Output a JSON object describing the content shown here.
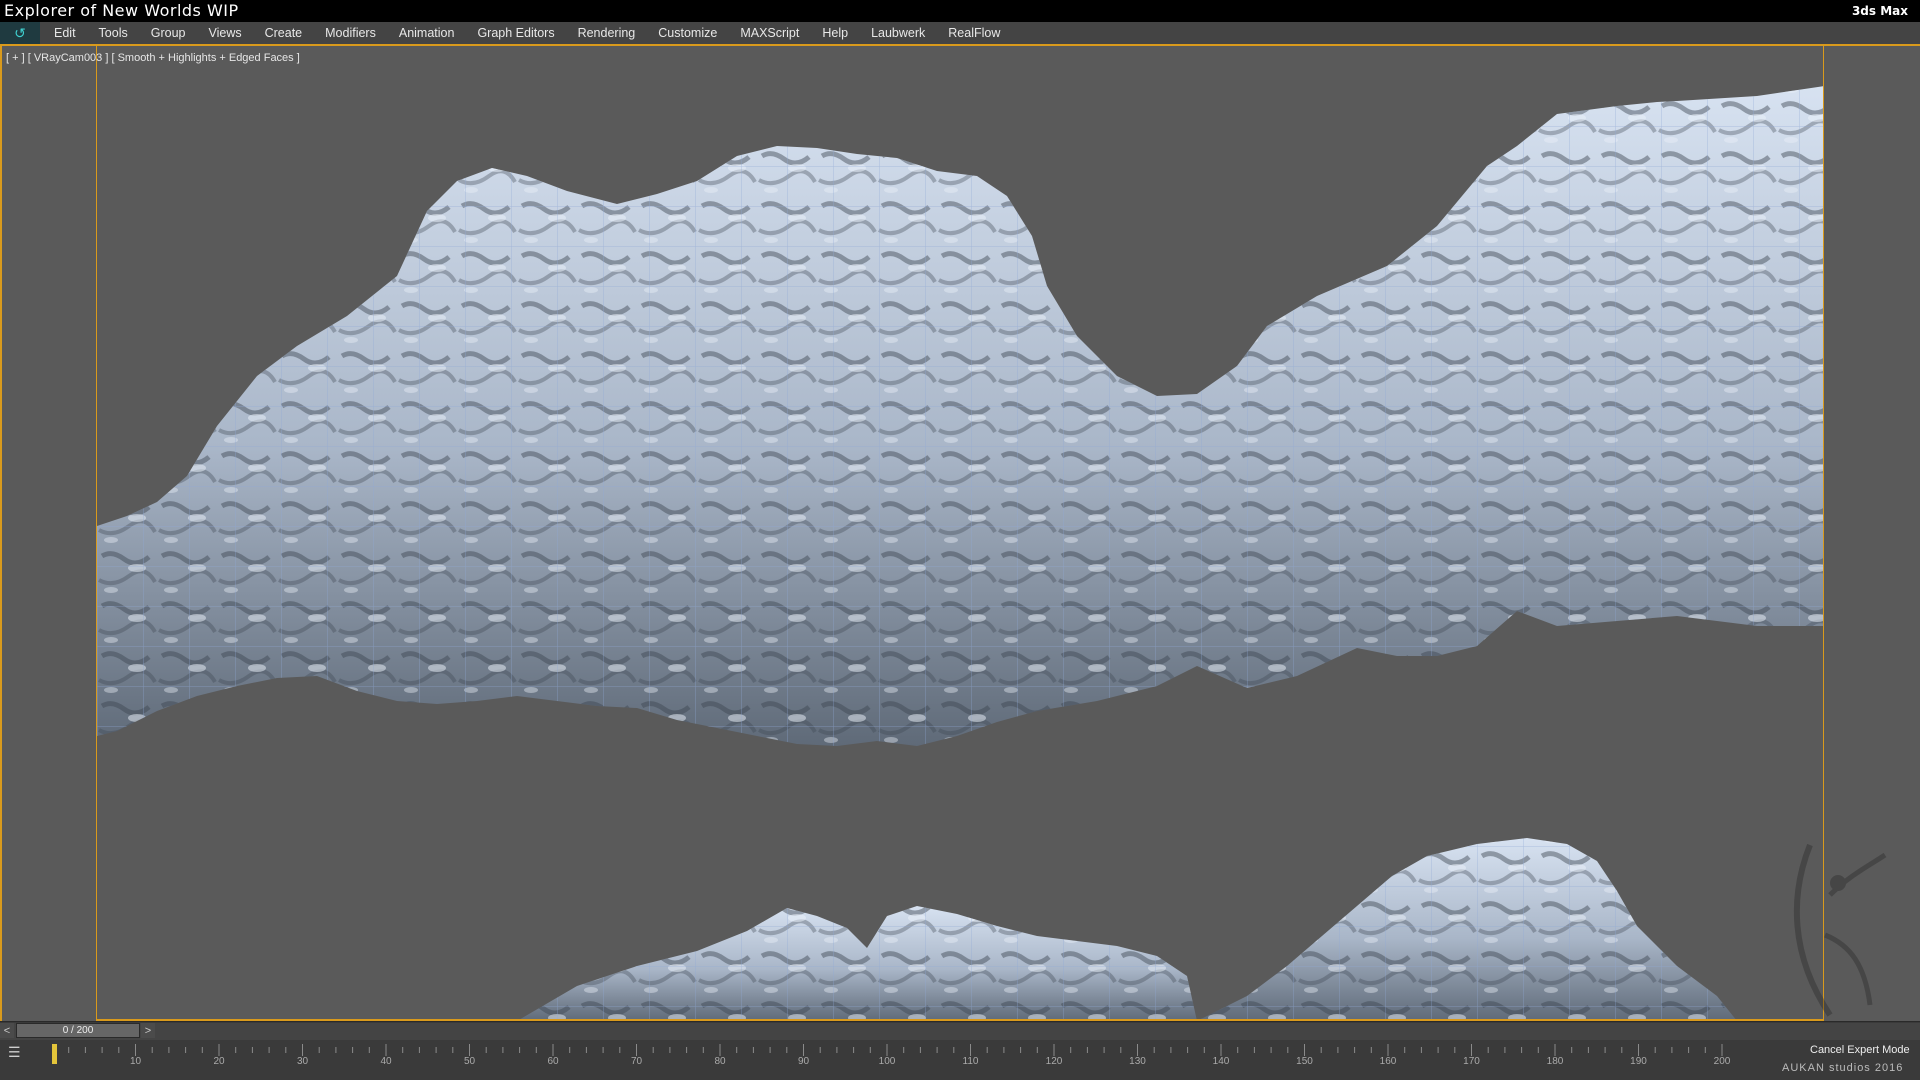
{
  "window": {
    "title": "Explorer of New Worlds WIP",
    "app_name": "3ds Max"
  },
  "menubar": {
    "items": [
      "Edit",
      "Tools",
      "Group",
      "Views",
      "Create",
      "Modifiers",
      "Animation",
      "Graph Editors",
      "Rendering",
      "Customize",
      "MAXScript",
      "Help",
      "Laubwerk",
      "RealFlow"
    ]
  },
  "viewport": {
    "label": "[ + ] [ VRayCam003 ] [ Smooth + Highlights + Edged Faces ]",
    "frame_color": "#d99a1c",
    "mesh_color": "#c9d6e8",
    "background": "#5a5a5a"
  },
  "timeline": {
    "frame_counter": "0 / 200",
    "prev_label": "<",
    "next_label": ">",
    "ticks": [
      "10",
      "20",
      "30",
      "40",
      "50",
      "60",
      "70",
      "80",
      "90",
      "100",
      "110",
      "120",
      "130",
      "140",
      "150",
      "160",
      "170",
      "180",
      "190",
      "200"
    ],
    "cancel_expert_mode": "Cancel Expert Mode"
  },
  "credit": "AUKAN studios 2016"
}
